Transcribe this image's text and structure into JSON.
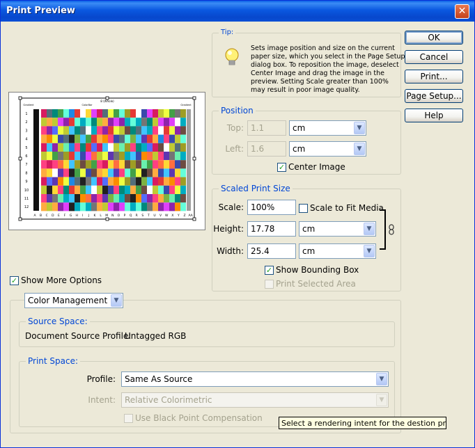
{
  "window": {
    "title": "Print Preview",
    "close_glyph": "✕"
  },
  "buttons": {
    "ok": "OK",
    "cancel": "Cancel",
    "print": "Print...",
    "page_setup": "Page Setup...",
    "help": "Help"
  },
  "tip": {
    "label": "Tip:",
    "icon": "lightbulb-icon",
    "lines": [
      "Sets image position and size on the current",
      "paper  size, which you select in the Page Setup",
      "dialog box. To reposition the image,  deselect",
      "Center Image and drag the image in the",
      "preview. Setting Scale greater  than 100%",
      "may result in poor image quality."
    ]
  },
  "position": {
    "label": "Position",
    "top_label": "Top:",
    "top_value": "1.1",
    "top_unit": "cm",
    "left_label": "Left:",
    "left_value": "1.6",
    "left_unit": "cm",
    "center_image": "Center Image",
    "center_image_checked": true
  },
  "scaled": {
    "label": "Scaled Print Size",
    "scale_label": "Scale:",
    "scale_value": "100%",
    "fit_media": "Scale to Fit Media",
    "fit_media_checked": false,
    "height_label": "Height:",
    "height_value": "17.78",
    "height_unit": "cm",
    "width_label": "Width:",
    "width_value": "25.4",
    "width_unit": "cm",
    "link_icon": "chain-link-icon",
    "bounding_box": "Show Bounding Box",
    "bounding_box_checked": true,
    "print_selected": "Print Selected Area",
    "print_selected_checked": false
  },
  "show_more": {
    "label": "Show More Options",
    "checked": true
  },
  "color": {
    "dropdown": "Color Management",
    "source_space": {
      "label": "Source Space:",
      "profile_label": "Document Source Profile:",
      "profile_value": "Untagged RGB"
    },
    "print_space": {
      "label": "Print Space:",
      "profile_label": "Profile:",
      "profile_value": "Same As Source",
      "intent_label": "Intent:",
      "intent_value": "Relative Colorimetric",
      "black_point": "Use Black Point Compensation"
    }
  },
  "tooltip": "Select a rendering intent for the destion printer",
  "preview": {
    "top_caption": "8 (Whole)",
    "top_left_caption": "Gradient",
    "top_mid_caption": "ColorBar",
    "top_right_caption": "Gradient",
    "row_numbers": [
      "1",
      "2",
      "3",
      "4",
      "5",
      "6",
      "7",
      "8",
      "9",
      "10",
      "11",
      "12"
    ],
    "column_letters": [
      "A",
      "B",
      "C",
      "D",
      "E",
      "F",
      "G",
      "H",
      "I",
      "J",
      "K",
      "L",
      "M",
      "N",
      "O",
      "P",
      "Q",
      "R",
      "S",
      "T",
      "U",
      "V",
      "W",
      "X",
      "Y",
      "Z",
      "AA"
    ],
    "palette": [
      "#d81b60",
      "#8e24aa",
      "#3949ab",
      "#1e88e5",
      "#00acc1",
      "#43a047",
      "#7cb342",
      "#c0ca33",
      "#fdd835",
      "#fb8c00",
      "#e53935",
      "#6d4c41",
      "#757575",
      "#546e7a",
      "#ff4081",
      "#e040fb",
      "#536dfe",
      "#40c4ff",
      "#64ffda",
      "#69f0ae",
      "#eeff41",
      "#ffab40",
      "#ff6e40",
      "#ffffff",
      "#212121",
      "#9e9d24",
      "#00897b",
      "#5e35b1"
    ]
  }
}
